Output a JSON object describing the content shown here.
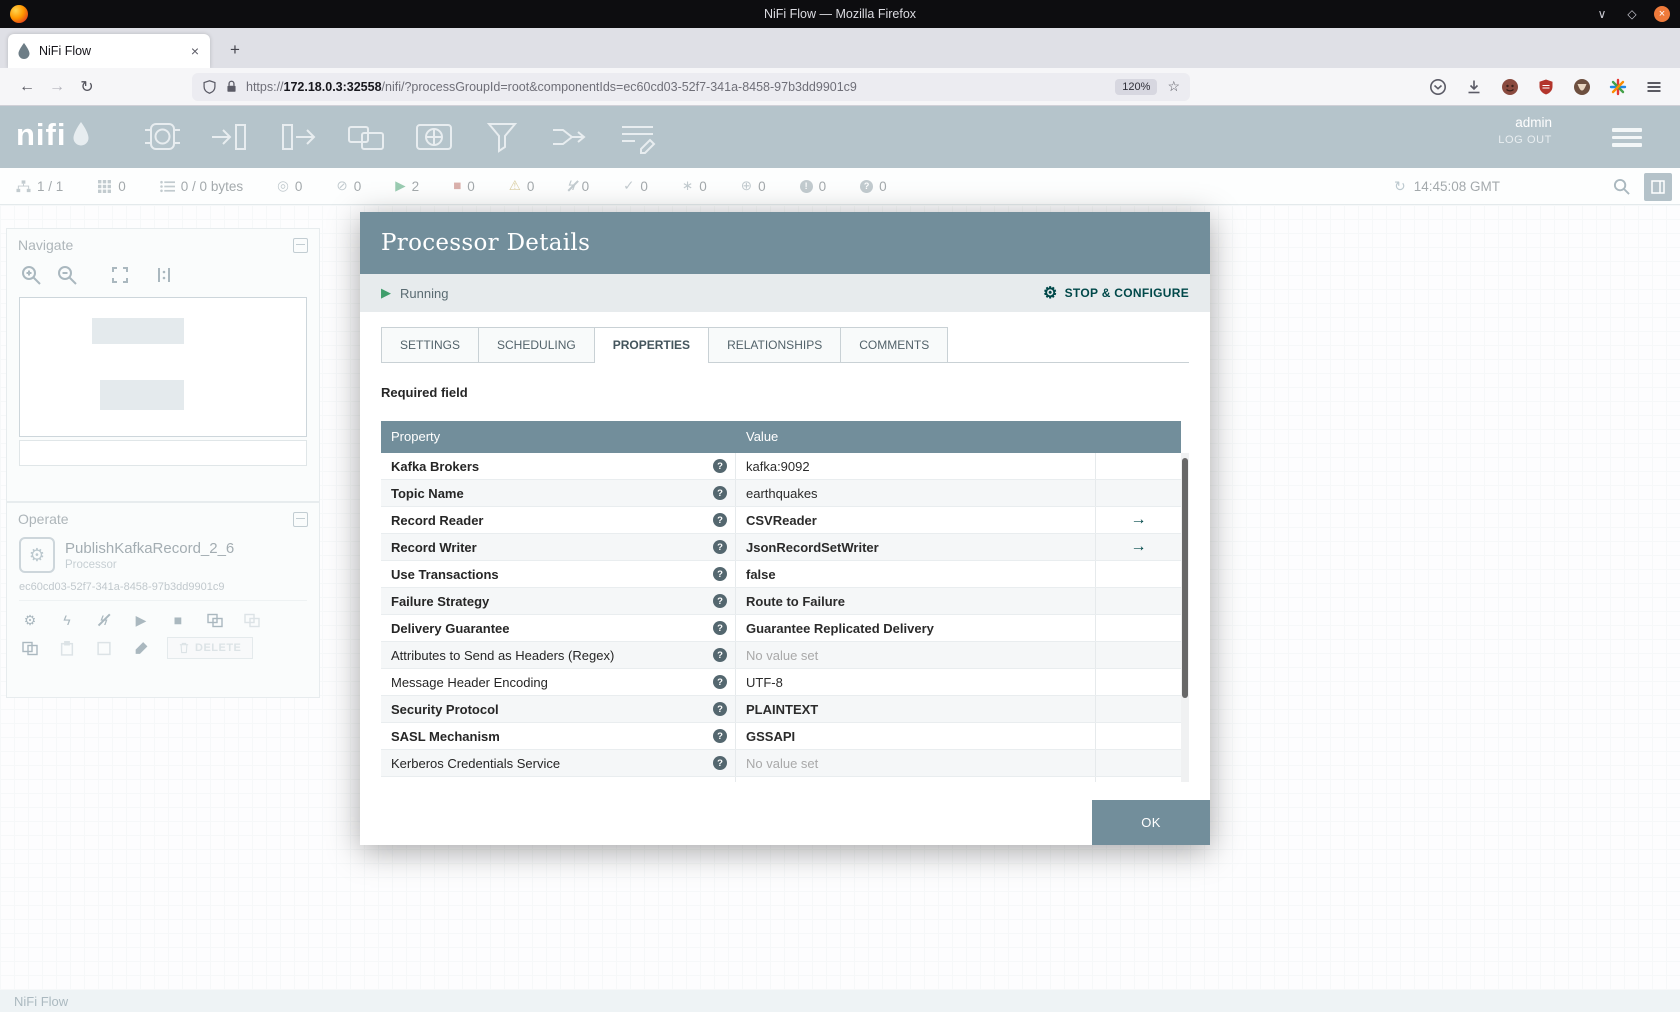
{
  "window": {
    "title": "NiFi Flow — Mozilla Firefox"
  },
  "browser": {
    "tab_title": "NiFi Flow",
    "new_tab": "+",
    "url_scheme": "https://",
    "url_host": "172.18.0.3:32558",
    "url_path": "/nifi/?processGroupId=root&componentIds=ec60cd03-52f7-341a-8458-97b3dd9901c9",
    "zoom": "120%",
    "action_icons": [
      "pocket",
      "downloads",
      "profile",
      "ublock",
      "badger",
      "pinwheel",
      "menu"
    ]
  },
  "nifi": {
    "logo": "nifi",
    "user": "admin",
    "logout_label": "LOG OUT",
    "toolbar_icons": [
      "processor",
      "input-port",
      "output-port",
      "process-group",
      "remote-process-group",
      "funnel",
      "template",
      "label"
    ],
    "status_bar": {
      "items": [
        {
          "icon": "cluster",
          "value": "1 / 1"
        },
        {
          "icon": "threads",
          "value": "0"
        },
        {
          "icon": "queued",
          "value": "0 / 0 bytes"
        },
        {
          "icon": "transmitting",
          "value": "0"
        },
        {
          "icon": "not-transmitting",
          "value": "0"
        },
        {
          "icon": "running",
          "value": "2"
        },
        {
          "icon": "stopped",
          "value": "0"
        },
        {
          "icon": "invalid",
          "value": "0"
        },
        {
          "icon": "disabled",
          "value": "0"
        },
        {
          "icon": "up-to-date",
          "value": "0"
        },
        {
          "icon": "locally-modified",
          "value": "0"
        },
        {
          "icon": "stale",
          "value": "0"
        },
        {
          "icon": "locally-modified-stale",
          "value": "0"
        },
        {
          "icon": "sync-failure",
          "value": "0"
        }
      ],
      "refresh_time": "14:45:08 GMT"
    },
    "navigate_panel": {
      "title": "Navigate"
    },
    "operate_panel": {
      "title": "Operate",
      "component_name": "PublishKafkaRecord_2_6",
      "component_type": "Processor",
      "component_id": "ec60cd03-52f7-341a-8458-97b3dd9901c9",
      "delete_label": "DELETE"
    },
    "breadcrumb": "NiFi Flow"
  },
  "dialog": {
    "title": "Processor Details",
    "status_label": "Running",
    "action_label": "STOP & CONFIGURE",
    "tabs": [
      "SETTINGS",
      "SCHEDULING",
      "PROPERTIES",
      "RELATIONSHIPS",
      "COMMENTS"
    ],
    "active_tab": "PROPERTIES",
    "required_note": "Required field",
    "table": {
      "headers": [
        "Property",
        "Value"
      ],
      "rows": [
        {
          "property": "Kafka Brokers",
          "value": "kafka:9092",
          "required": true,
          "value_bold": false,
          "unset": false,
          "goto": false
        },
        {
          "property": "Topic Name",
          "value": "earthquakes",
          "required": true,
          "value_bold": false,
          "unset": false,
          "goto": false
        },
        {
          "property": "Record Reader",
          "value": "CSVReader",
          "required": true,
          "value_bold": true,
          "unset": false,
          "goto": true
        },
        {
          "property": "Record Writer",
          "value": "JsonRecordSetWriter",
          "required": true,
          "value_bold": true,
          "unset": false,
          "goto": true
        },
        {
          "property": "Use Transactions",
          "value": "false",
          "required": true,
          "value_bold": true,
          "unset": false,
          "goto": false
        },
        {
          "property": "Failure Strategy",
          "value": "Route to Failure",
          "required": true,
          "value_bold": true,
          "unset": false,
          "goto": false
        },
        {
          "property": "Delivery Guarantee",
          "value": "Guarantee Replicated Delivery",
          "required": true,
          "value_bold": true,
          "unset": false,
          "goto": false
        },
        {
          "property": "Attributes to Send as Headers (Regex)",
          "value": "No value set",
          "required": false,
          "value_bold": false,
          "unset": true,
          "goto": false
        },
        {
          "property": "Message Header Encoding",
          "value": "UTF-8",
          "required": false,
          "value_bold": false,
          "unset": false,
          "goto": false
        },
        {
          "property": "Security Protocol",
          "value": "PLAINTEXT",
          "required": true,
          "value_bold": true,
          "unset": false,
          "goto": false
        },
        {
          "property": "SASL Mechanism",
          "value": "GSSAPI",
          "required": true,
          "value_bold": true,
          "unset": false,
          "goto": false
        },
        {
          "property": "Kerberos Credentials Service",
          "value": "No value set",
          "required": false,
          "value_bold": false,
          "unset": true,
          "goto": false
        }
      ]
    },
    "ok_label": "OK"
  },
  "colors": {
    "nifi_teal": "#728e9b",
    "action_teal": "#004849",
    "running_green": "#3f9d6b"
  }
}
